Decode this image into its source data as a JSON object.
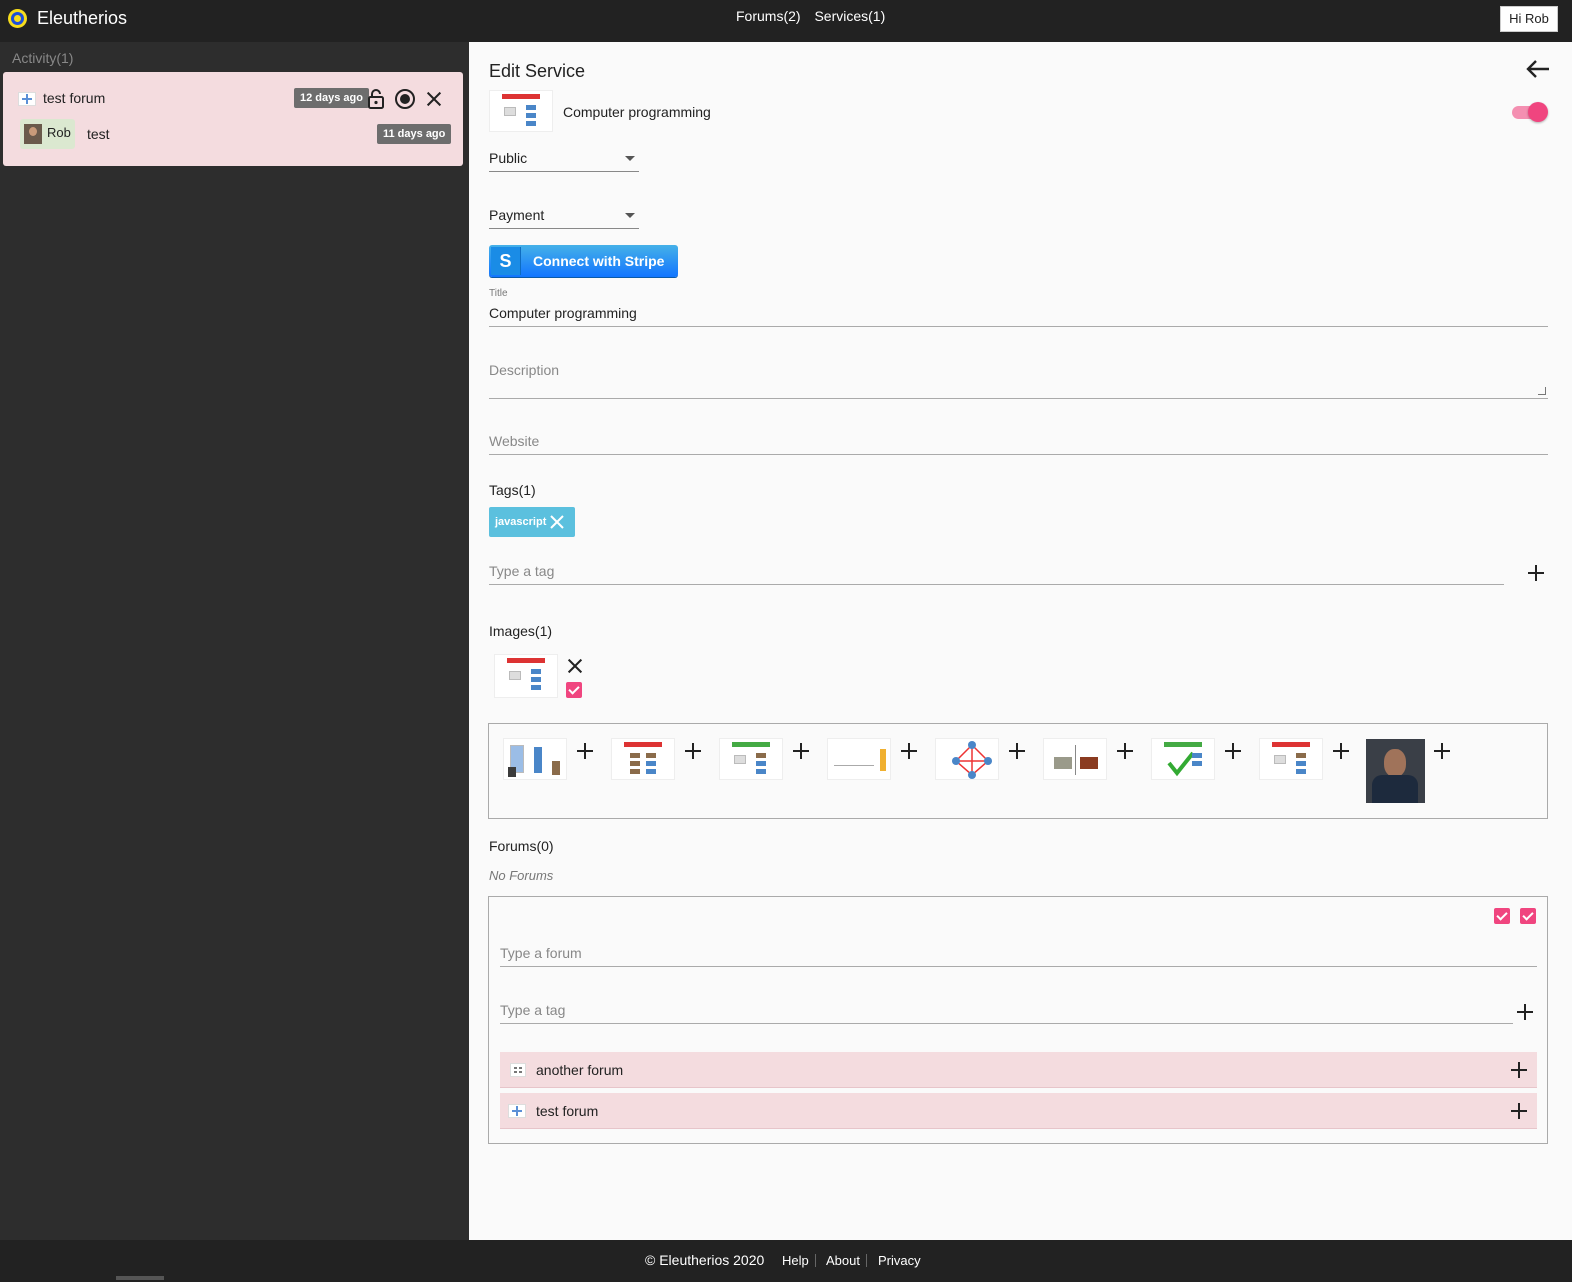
{
  "app": {
    "brand": "Eleutherios",
    "nav": {
      "forums": "Forums(2)",
      "services": "Services(1)"
    },
    "user_button": "Hi Rob"
  },
  "activity": {
    "title": "Activity(1)",
    "forum_name": "test forum",
    "forum_time": "12 days ago",
    "user_name": "Rob",
    "message": "test",
    "message_time": "11 days ago",
    "icons": [
      "forum-icon",
      "lock-open-icon",
      "radio-target-icon",
      "close-icon",
      "avatar"
    ]
  },
  "edit": {
    "heading": "Edit Service",
    "service_name": "Computer programming",
    "active": true,
    "visibility": "Public",
    "type": "Payment",
    "stripe_label": "Connect with Stripe",
    "stripe_letter": "S",
    "title_label": "Title",
    "title_value": "Computer programming",
    "description_placeholder": "Description",
    "website_placeholder": "Website",
    "tags_heading": "Tags(1)",
    "tags": [
      "javascript"
    ],
    "tag_placeholder": "Type a tag",
    "images_heading": "Images(1)",
    "forums_heading": "Forums(0)",
    "no_forums": "No Forums",
    "forum_search_placeholder": "Type a forum",
    "forum_tag_placeholder": "Type a tag",
    "forum_results": [
      {
        "name": "another forum",
        "icon": "grid-icon"
      },
      {
        "name": "test forum",
        "icon": "forum-icon"
      }
    ]
  },
  "colors": {
    "accent": "#f0457f",
    "card": "#f4dcdf",
    "tag": "#5bc0de",
    "stripe": "#1275ff"
  },
  "footer": {
    "copyright": "© Eleutherios 2020",
    "links": [
      "Help",
      "About",
      "Privacy"
    ]
  }
}
